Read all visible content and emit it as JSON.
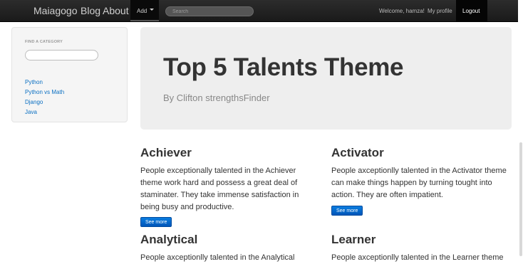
{
  "navbar": {
    "brand": "Maiagogo",
    "blog": "Blog",
    "about": "About",
    "add": "Add",
    "search_placeholder": "Search",
    "welcome": "Welcome, hamza!",
    "profile": "My profile",
    "logout": "Logout"
  },
  "sidebar": {
    "title": "FIND A CATEGORY",
    "categories": [
      "Python",
      "Python vs Math",
      "Django",
      "Java"
    ]
  },
  "hero": {
    "title": "Top 5 Talents Theme",
    "subtitle": "By Clifton strengthsFinder"
  },
  "talents": [
    {
      "title": "Achiever",
      "text": "People exceptionally talented in the Achiever theme work hard and possess a great deal of staminater. They take immense satisfaction in being busy and productive.",
      "button": "See more"
    },
    {
      "title": "Activator",
      "text": "People axceptionlly talented in the Activator theme can make things happen by turning tought into action. They are often impatient.",
      "button": "See more"
    },
    {
      "title": "Analytical",
      "text": "People axceptionlly talented in the Analytical"
    },
    {
      "title": "Learner",
      "text": "People axceptionlly talented in the Learner theme"
    }
  ]
}
